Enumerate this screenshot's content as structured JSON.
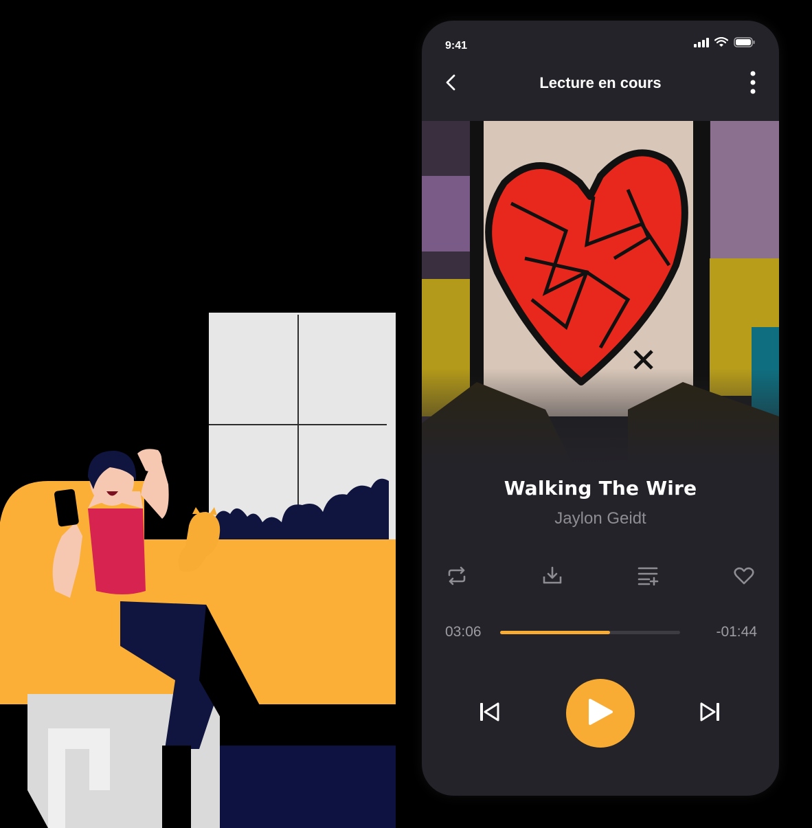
{
  "status_bar": {
    "time": "9:41"
  },
  "nav": {
    "title": "Lecture en cours"
  },
  "track": {
    "title": "Walking The Wire",
    "artist": "Jaylon Geidt",
    "elapsed": "03:06",
    "remaining": "-01:44",
    "progress": 0.61
  },
  "icons": {
    "back": "chevron-left-icon",
    "more": "more-vertical-icon",
    "repeat": "repeat-icon",
    "download": "download-icon",
    "add_to_playlist": "playlist-add-icon",
    "favorite": "heart-icon",
    "previous": "skip-previous-icon",
    "play": "play-icon",
    "next": "skip-next-icon"
  },
  "colors": {
    "accent": "#F9AC34",
    "phone_background": "#242329",
    "heart_red": "#E8281C"
  }
}
